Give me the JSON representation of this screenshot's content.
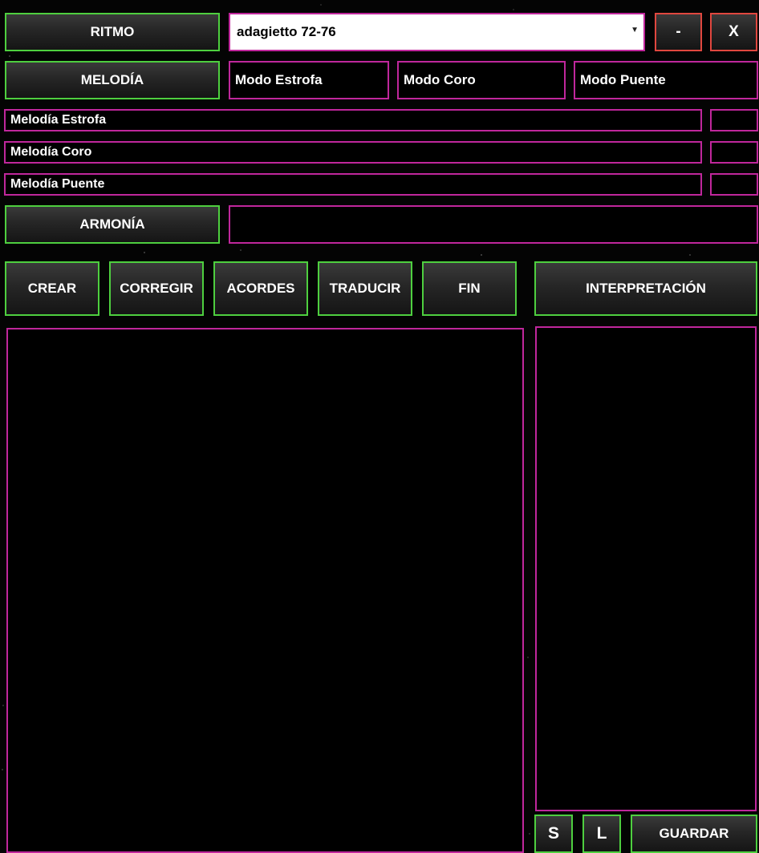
{
  "top": {
    "ritmo_label": "RITMO",
    "ritmo_select_value": "adagietto  72-76",
    "minimize_label": "-",
    "close_label": "X"
  },
  "melodia": {
    "button_label": "MELODÍA",
    "modes": [
      "Modo Estrofa",
      "Modo Coro",
      "Modo Puente"
    ],
    "fields": [
      "Melodía Estrofa",
      "Melodía Coro",
      "Melodía Puente"
    ]
  },
  "armonia": {
    "button_label": "ARMONÍA"
  },
  "actions": {
    "crear": "CREAR",
    "corregir": "CORREGIR",
    "acordes": "ACORDES",
    "traducir": "TRADUCIR",
    "fin": "FIN",
    "interpretacion": "INTERPRETACIÓN"
  },
  "bottom": {
    "s_label": "S",
    "l_label": "L",
    "guardar_label": "GUARDAR"
  },
  "icons": {
    "dropdown": "chevron-down-icon"
  },
  "colors": {
    "accent_green": "#4ecf3f",
    "accent_magenta": "#c0279c",
    "accent_red": "#e0473f"
  }
}
